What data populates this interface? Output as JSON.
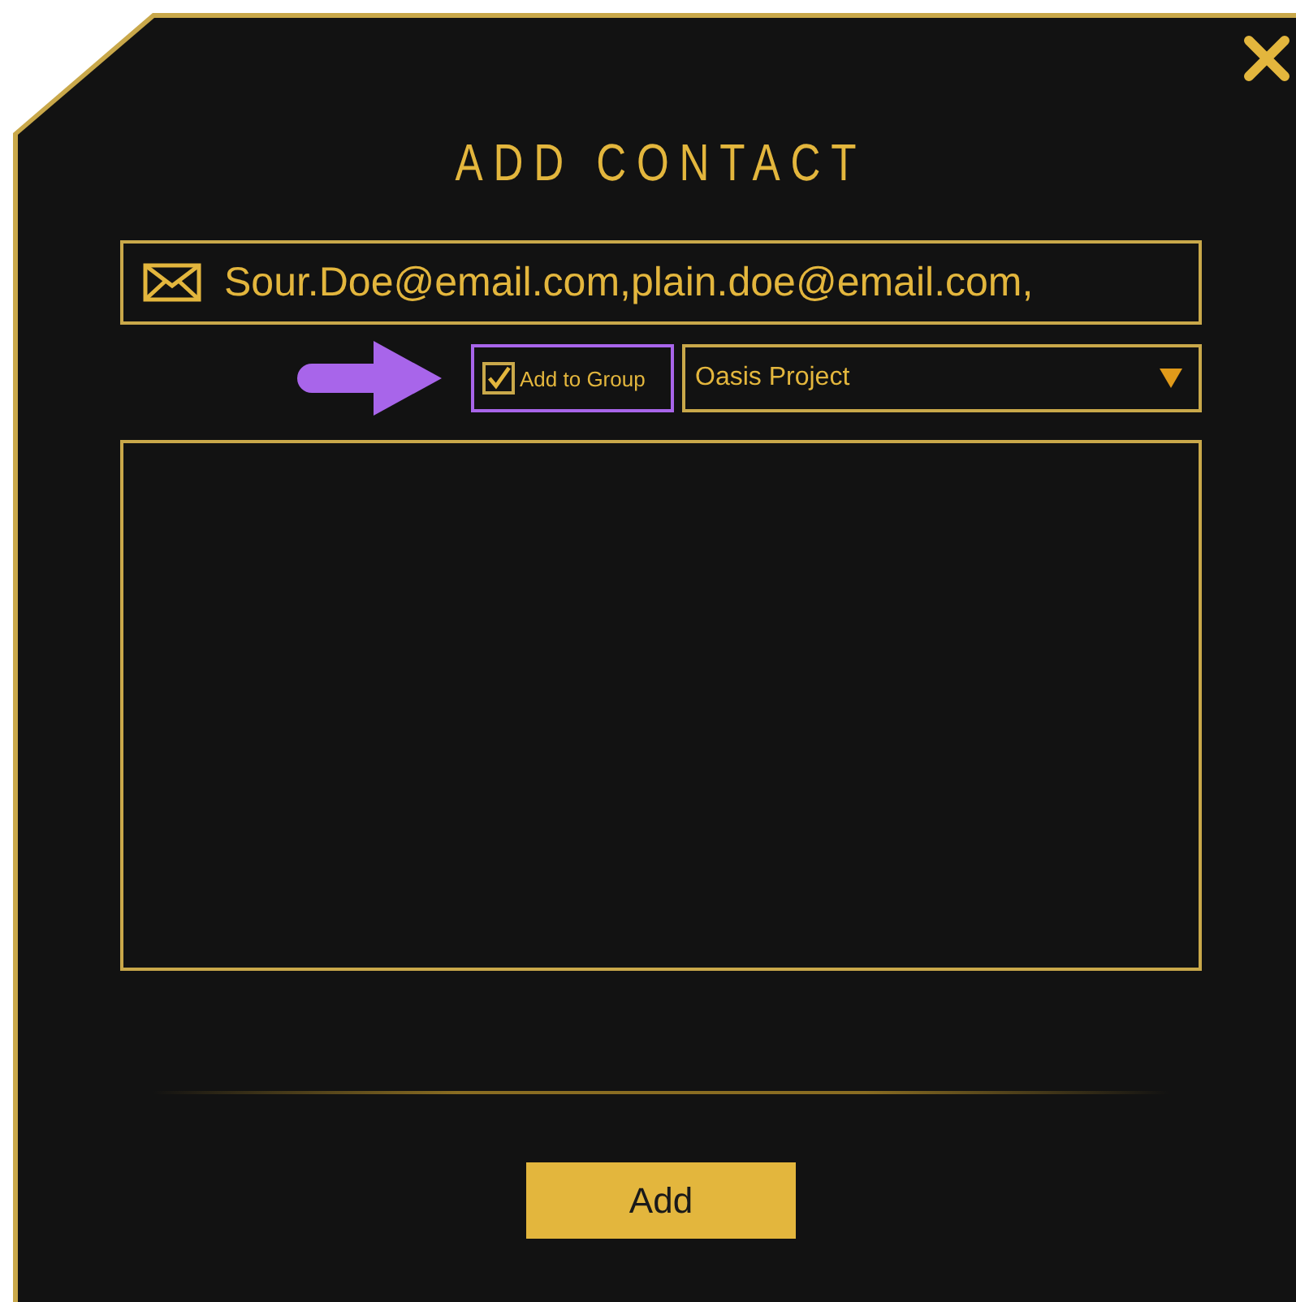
{
  "dialog": {
    "title": "ADD CONTACT"
  },
  "email_field": {
    "value": "Sour.Doe@email.com,plain.doe@email.com,"
  },
  "add_to_group": {
    "label": "Add to Group",
    "checked": true
  },
  "group_dropdown": {
    "value": "Oasis Project"
  },
  "buttons": [
    {
      "label": "Add"
    }
  ]
}
